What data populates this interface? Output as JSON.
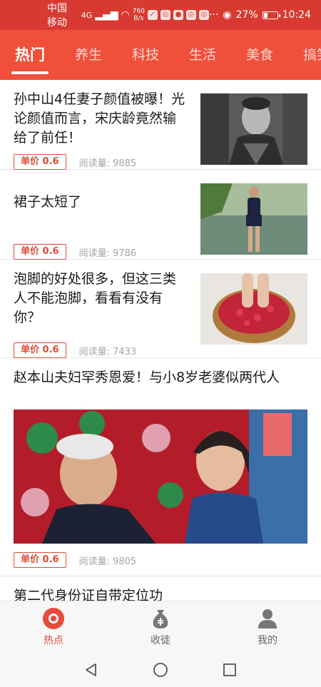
{
  "status_bar": {
    "carrier": "中国移动",
    "network": "4G",
    "speed_value": "760",
    "speed_unit": "B/s",
    "battery": "27%",
    "time": "10:24"
  },
  "tabs": [
    {
      "label": "热门",
      "active": true
    },
    {
      "label": "养生",
      "active": false
    },
    {
      "label": "科技",
      "active": false
    },
    {
      "label": "生活",
      "active": false
    },
    {
      "label": "美食",
      "active": false
    },
    {
      "label": "搞笑",
      "active": false
    }
  ],
  "articles": [
    {
      "title": "孙中山4任妻子颜值被曝！光论颜值而言，宋庆龄竟然输给了前任！",
      "price": "单价 0.6",
      "reads": "阅读量: 9885"
    },
    {
      "title": "裙子太短了",
      "price": "单价 0.6",
      "reads": "阅读量: 9786"
    },
    {
      "title": "泡脚的好处很多，但这三类人不能泡脚，看看有没有你？",
      "price": "单价 0.6",
      "reads": "阅读量: 7433"
    },
    {
      "title": "赵本山夫妇罕秀恩爱！与小8岁老婆似两代人",
      "price": "单价 0.6",
      "reads": "阅读量: 9805"
    },
    {
      "title": "第二代身份证自带定位功"
    }
  ],
  "bottom_nav": [
    {
      "label": "热点",
      "icon": "hotspot-icon",
      "active": true
    },
    {
      "label": "收徒",
      "icon": "money-bag-icon",
      "active": false
    },
    {
      "label": "我的",
      "icon": "person-icon",
      "active": false
    }
  ],
  "colors": {
    "status_bar": "#d83a31",
    "tab_bar": "#f0503a",
    "accent": "#e04a3a"
  }
}
